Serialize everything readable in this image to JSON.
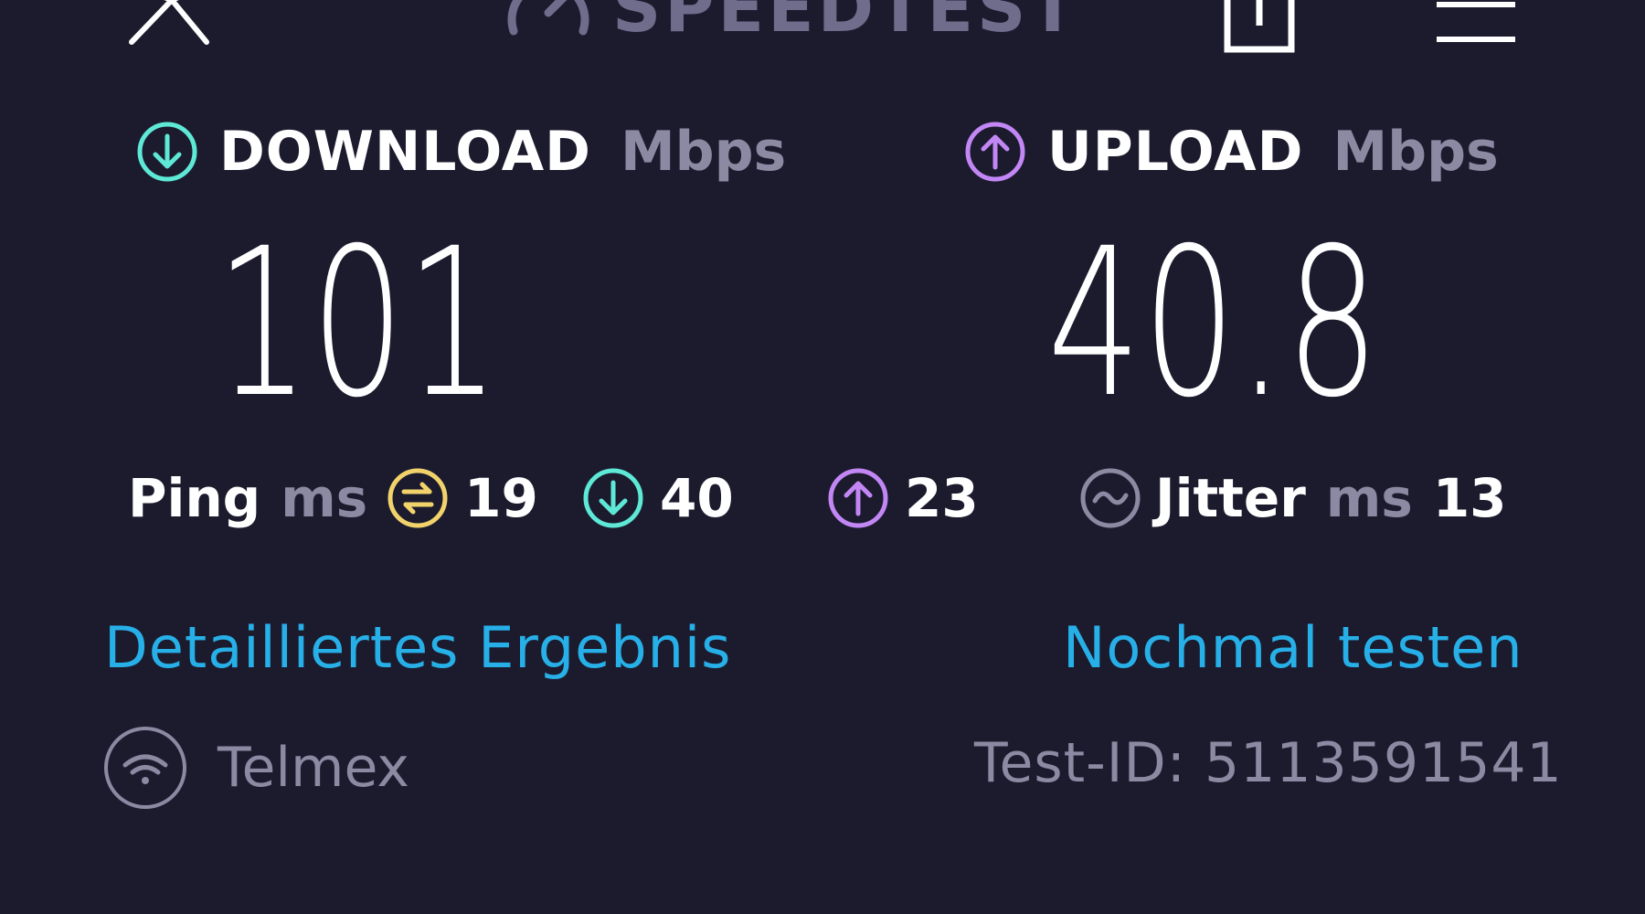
{
  "header": {
    "logo_text": "SPEEDTEST",
    "close_icon": "close-icon",
    "share_icon": "share-icon",
    "menu_icon": "menu-icon"
  },
  "download": {
    "label": "DOWNLOAD",
    "unit": "Mbps",
    "value": "101",
    "color": "#5ee8d6"
  },
  "upload": {
    "label": "UPLOAD",
    "unit": "Mbps",
    "value": "40.8",
    "color": "#c287f5"
  },
  "ping": {
    "label": "Ping",
    "unit": "ms",
    "idle": "19",
    "download": "40",
    "upload": "23",
    "idle_color": "#f2d36b"
  },
  "jitter": {
    "label": "Jitter",
    "unit": "ms",
    "value": "13",
    "color": "#8c8aa3"
  },
  "links": {
    "details": "Detailliertes Ergebnis",
    "retest": "Nochmal testen",
    "color": "#27b0e8"
  },
  "footer": {
    "provider": "Telmex",
    "test_id": "Test-ID: 5113591541",
    "provider_icon": "wifi-icon"
  }
}
